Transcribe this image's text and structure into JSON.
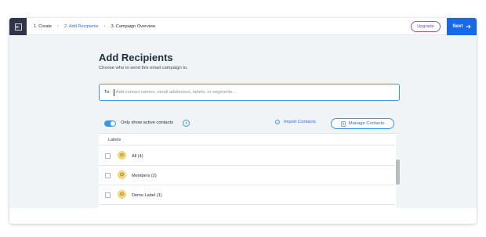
{
  "header": {
    "back_icon": "exit-icon",
    "steps": [
      "1. Create",
      "2. Add Recipients",
      "3. Campaign Overview"
    ],
    "active_step": 1,
    "upgrade_label": "Upgrade",
    "next_label": "Next",
    "accent_color": "#166aea"
  },
  "main": {
    "title": "Add Recipients",
    "subtitle": "Choose who to send this email campaign to.",
    "to_label": "To:",
    "to_placeholder": "Add contact names, email addresses, labels, or segments...",
    "to_value": ""
  },
  "toolbar": {
    "toggle_label": "Only show active contacts",
    "toggle_on": true,
    "import_label": "Import Contacts",
    "manage_label": "Manage Contacts"
  },
  "labels": {
    "header": "Labels",
    "items": [
      {
        "label": "All (4)",
        "avatar": "smiley-icon"
      },
      {
        "label": "Members (2)",
        "avatar": "smiley-icon"
      },
      {
        "label": "Demo Label (1)",
        "avatar": "smiley-icon"
      }
    ]
  }
}
